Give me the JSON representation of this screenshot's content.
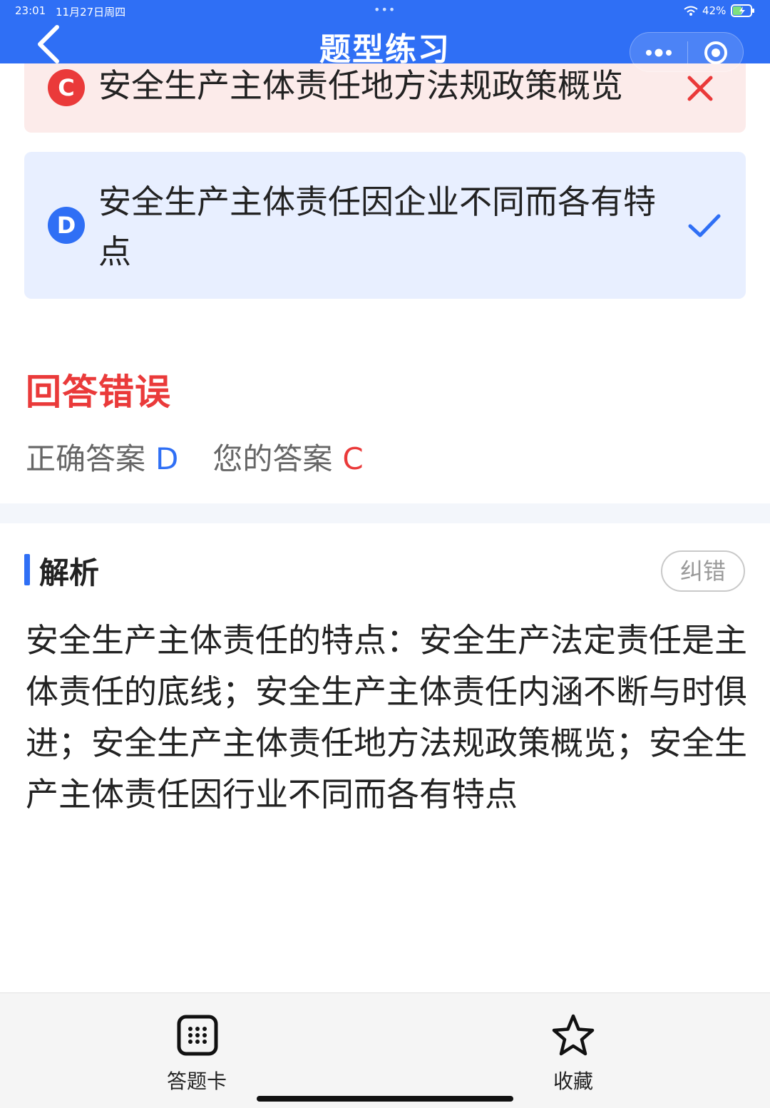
{
  "status_bar": {
    "time": "23:01",
    "date": "11月27日周四",
    "dots": "•••",
    "battery": "42%"
  },
  "header": {
    "title": "题型练习",
    "icons": {
      "back": "chevron-left-icon",
      "more": "more-dots-icon",
      "close": "target-circle-icon"
    }
  },
  "options": [
    {
      "letter": "C",
      "text": "安全生产主体责任地方法规政策概览",
      "state": "wrong",
      "icon": "close-icon"
    },
    {
      "letter": "D",
      "text": "安全生产主体责任因企业不同而各有特点",
      "state": "correct",
      "icon": "check-icon"
    }
  ],
  "result": {
    "title": "回答错误",
    "correct_label": "正确答案",
    "correct_answer": "D",
    "your_label": "您的答案",
    "your_answer": "C"
  },
  "analysis": {
    "title": "解析",
    "report_button": "纠错",
    "text": "安全生产主体责任的特点：安全生产法定责任是主体责任的底线；安全生产主体责任内涵不断与时俱进；安全生产主体责任地方法规政策概览；安全生产主体责任因行业不同而各有特点"
  },
  "bottom_bar": {
    "answer_card_label": "答题卡",
    "favorite_label": "收藏",
    "icons": {
      "answer_card": "grid-icon",
      "favorite": "star-icon"
    }
  },
  "colors": {
    "primary": "#2f6ff5",
    "error": "#ea3a3a",
    "wrong_bg": "#fcebea",
    "correct_bg": "#e8efff"
  }
}
